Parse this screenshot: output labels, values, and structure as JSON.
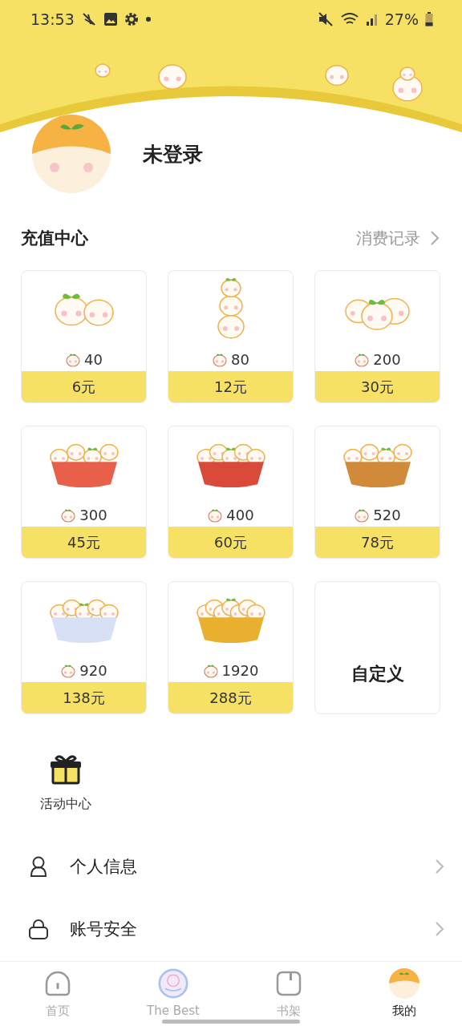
{
  "status_bar": {
    "time": "13:53",
    "battery": "27%"
  },
  "profile": {
    "name": "未登录"
  },
  "recharge": {
    "title": "充值中心",
    "link": "消费记录",
    "packages": [
      {
        "kind": "package",
        "coins": "40",
        "price": "6元"
      },
      {
        "kind": "package",
        "coins": "80",
        "price": "12元"
      },
      {
        "kind": "package",
        "coins": "200",
        "price": "30元"
      },
      {
        "kind": "package",
        "coins": "300",
        "price": "45元"
      },
      {
        "kind": "package",
        "coins": "400",
        "price": "60元"
      },
      {
        "kind": "package",
        "coins": "520",
        "price": "78元"
      },
      {
        "kind": "package",
        "coins": "920",
        "price": "138元"
      },
      {
        "kind": "package",
        "coins": "1920",
        "price": "288元"
      },
      {
        "kind": "custom",
        "label": "自定义"
      }
    ]
  },
  "activities": [
    {
      "label": "活动中心"
    }
  ],
  "menu": [
    {
      "kind": "person",
      "label": "个人信息"
    },
    {
      "kind": "lock",
      "label": "账号安全"
    }
  ],
  "nav": [
    {
      "kind": "home",
      "label": "首页",
      "selected": false
    },
    {
      "kind": "badge",
      "label": "The Best",
      "selected": false
    },
    {
      "kind": "shelf",
      "label": "书架",
      "selected": false
    },
    {
      "kind": "avatar",
      "label": "我的",
      "selected": true
    }
  ]
}
